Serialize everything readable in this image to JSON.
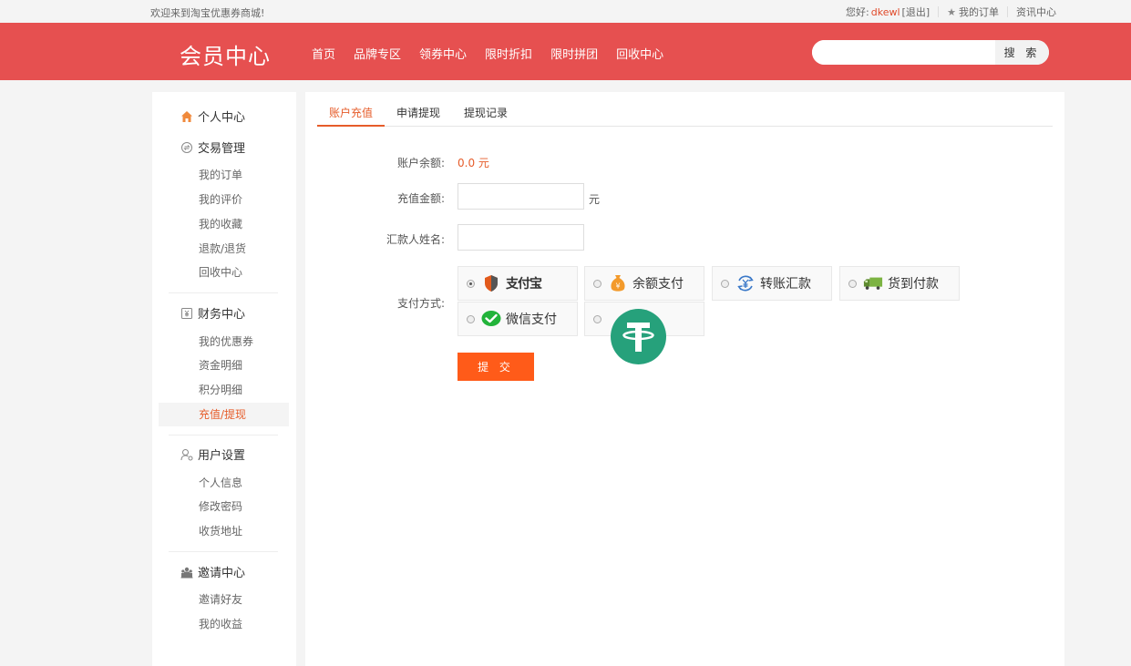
{
  "topbar": {
    "welcome": "欢迎来到淘宝优惠券商城!",
    "greeting": "您好:",
    "username": "dkewl",
    "logout": "[退出]",
    "my_orders": "我的订单",
    "news_center": "资讯中心"
  },
  "header": {
    "brand": "会员中心",
    "nav": [
      "首页",
      "品牌专区",
      "领券中心",
      "限时折扣",
      "限时拼团",
      "回收中心"
    ],
    "search_placeholder": "",
    "search_button": "搜 索"
  },
  "sidebar": {
    "personal": "个人中心",
    "trade": {
      "title": "交易管理",
      "items": [
        "我的订单",
        "我的评价",
        "我的收藏",
        "退款/退货",
        "回收中心"
      ]
    },
    "finance": {
      "title": "财务中心",
      "items": [
        "我的优惠券",
        "资金明细",
        "积分明细",
        "充值/提现"
      ]
    },
    "settings": {
      "title": "用户设置",
      "items": [
        "个人信息",
        "修改密码",
        "收货地址"
      ]
    },
    "invite": {
      "title": "邀请中心",
      "items": [
        "邀请好友",
        "我的收益"
      ]
    },
    "active_item": "充值/提现"
  },
  "main": {
    "tabs": [
      "账户充值",
      "申请提现",
      "提现记录"
    ],
    "active_tab": "账户充值",
    "form": {
      "balance_label": "账户余额:",
      "balance_value": "0.0 元",
      "amount_label": "充值金额:",
      "amount_value": "",
      "amount_unit": "元",
      "payer_label": "汇款人姓名:",
      "payer_value": "",
      "payment_label": "支付方式:",
      "payment_methods": [
        {
          "label": "支付宝",
          "icon": "alipay-logo",
          "selected": true
        },
        {
          "label": "余额支付",
          "icon": "money-bag-icon",
          "selected": false
        },
        {
          "label": "转账汇款",
          "icon": "yuan-transfer-icon",
          "selected": false
        },
        {
          "label": "货到付款",
          "icon": "truck-icon",
          "selected": false
        },
        {
          "label": "微信支付",
          "icon": "wechat-icon",
          "selected": false
        },
        {
          "label": "",
          "icon": "tether-icon",
          "selected": false
        }
      ],
      "submit": "提 交"
    }
  },
  "colors": {
    "header_bg": "#e65050",
    "accent": "#e65c2a",
    "submit_bg": "#ff5b19",
    "tether": "#26a17b",
    "wechat": "#22b33a"
  }
}
